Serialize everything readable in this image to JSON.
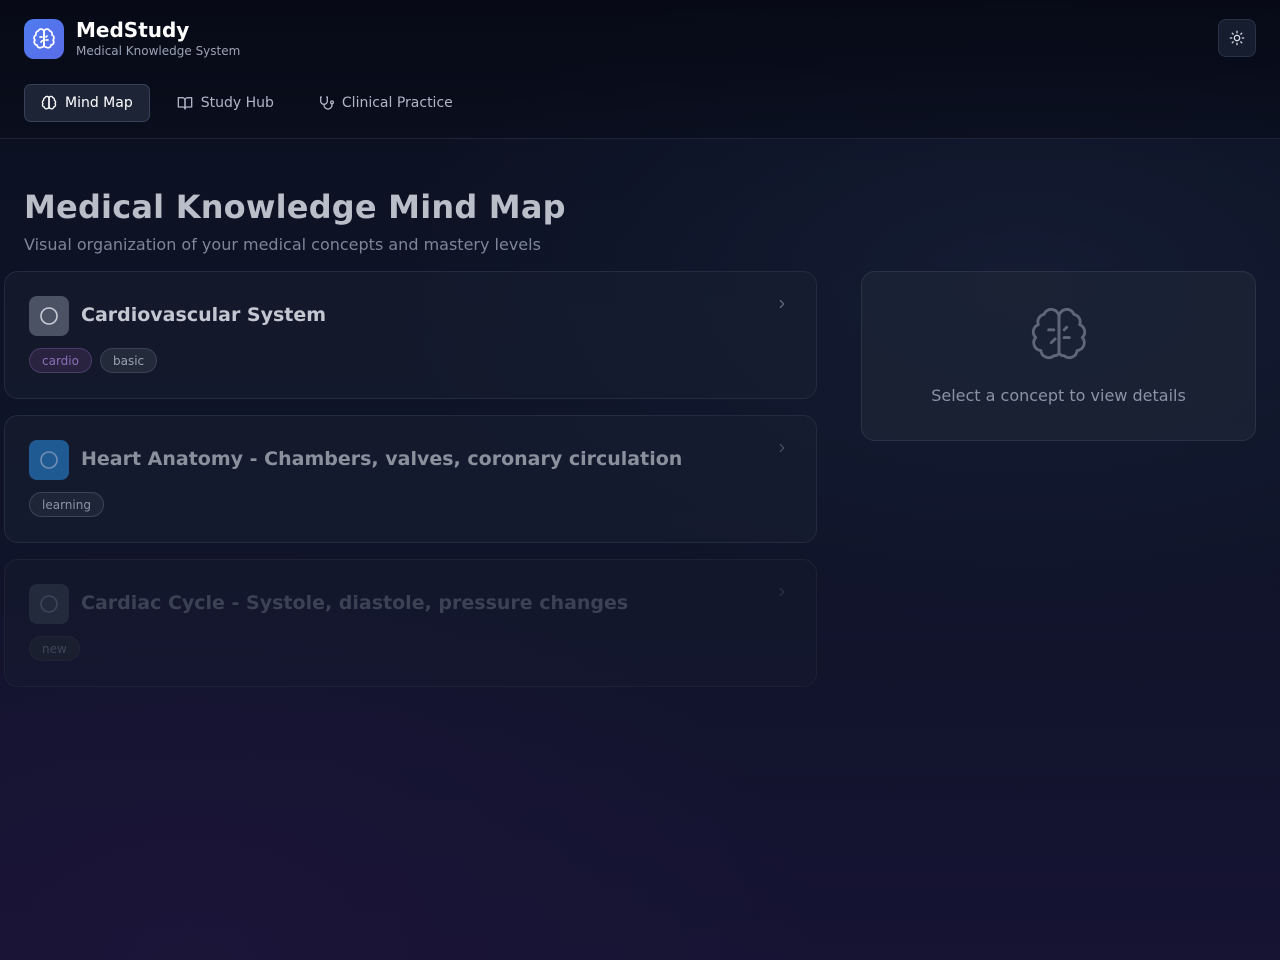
{
  "app": {
    "title": "MedStudy",
    "subtitle": "Medical Knowledge System",
    "logo_icon": "brain-icon",
    "theme_toggle_icon": "sun-icon"
  },
  "nav": {
    "tabs": [
      {
        "label": "Mind Map",
        "icon": "brain-icon",
        "active": true
      },
      {
        "label": "Study Hub",
        "icon": "book-open-icon",
        "active": false
      },
      {
        "label": "Clinical Practice",
        "icon": "stethoscope-icon",
        "active": false
      }
    ]
  },
  "main": {
    "title": "Medical Knowledge Mind Map",
    "subtitle": "Visual organization of your medical concepts and mastery levels"
  },
  "concepts": [
    {
      "title": "Cardiovascular System",
      "tags": [
        "cardio",
        "basic"
      ],
      "icon": "circle-icon",
      "icon_color": "#4a5263"
    },
    {
      "title": "Heart Anatomy - Chambers, valves, coronary circulation",
      "tags": [
        "learning"
      ],
      "icon": "circle-icon",
      "icon_color": "#1f5a93"
    },
    {
      "title": "Cardiac Cycle - Systole, diastole, pressure changes",
      "tags": [
        "new"
      ],
      "icon": "circle-icon",
      "icon_color": "#232a3c"
    }
  ],
  "detail_panel": {
    "icon": "brain-icon",
    "empty_text": "Select a concept to view details"
  },
  "colors": {
    "accent": "#4f7cf0",
    "background": "#0f1428",
    "card_border": "#232b3e",
    "tag_cardio": "#8a6fb8"
  }
}
